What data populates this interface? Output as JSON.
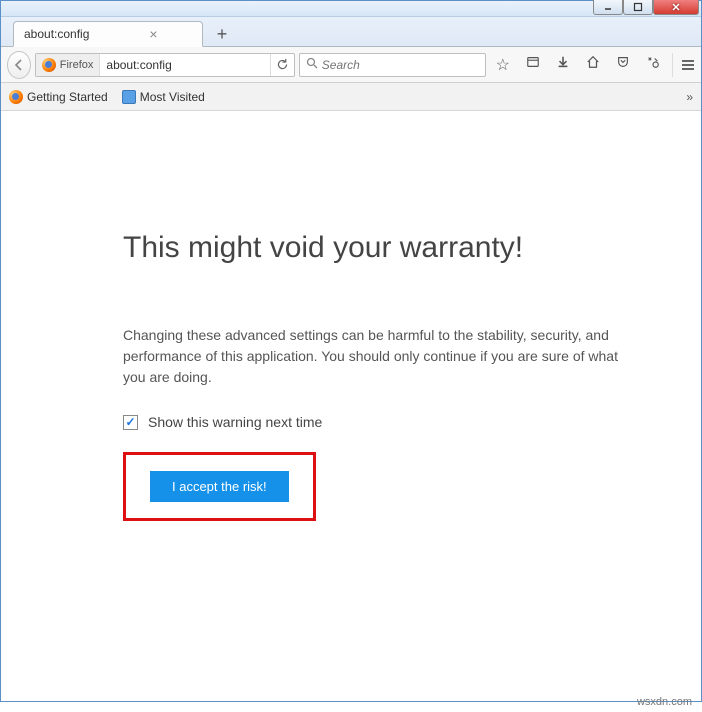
{
  "window": {
    "controls": {
      "min": "–",
      "max": "▢",
      "close": "✕"
    }
  },
  "tabs": {
    "active_label": "about:config",
    "newtab_label": "+"
  },
  "nav": {
    "identity_label": "Firefox",
    "url": "about:config",
    "search_placeholder": "Search"
  },
  "bookmarks": {
    "item1": "Getting Started",
    "item2": "Most Visited",
    "overflow": "»"
  },
  "page": {
    "heading": "This might void your warranty!",
    "body": "Changing these advanced settings can be harmful to the stability, security, and performance of this application. You should only continue if you are sure of what you are doing.",
    "checkbox_label": "Show this warning next time",
    "checkbox_checked": true,
    "button_label": "I accept the risk!"
  },
  "watermark": "wsxdn.com"
}
